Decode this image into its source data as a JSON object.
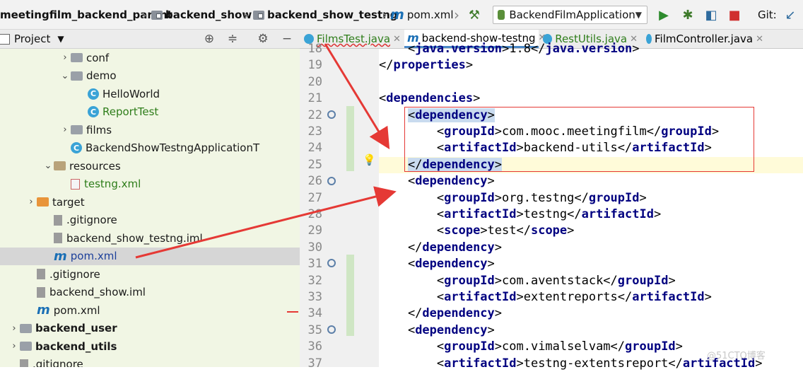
{
  "breadcrumb": {
    "items": [
      "meetingfilm_backend_parent",
      "backend_show",
      "backend_show_testng",
      "pom.xml"
    ]
  },
  "toolbar": {
    "run_config": "BackendFilmApplication",
    "git_label": "Git:"
  },
  "project_panel": {
    "title": "Project",
    "tree": [
      {
        "label": "conf",
        "type": "folder",
        "indent": 2,
        "expanded": false
      },
      {
        "label": "demo",
        "type": "folder",
        "indent": 2,
        "expanded": true
      },
      {
        "label": "HelloWorld",
        "type": "class",
        "indent": 3
      },
      {
        "label": "ReportTest",
        "type": "class",
        "indent": 3,
        "color": "green"
      },
      {
        "label": "films",
        "type": "folder",
        "indent": 2,
        "expanded": false
      },
      {
        "label": "BackendShowTestngApplicationT",
        "type": "class",
        "indent": 2
      },
      {
        "label": "resources",
        "type": "res-folder",
        "indent": 1,
        "expanded": true
      },
      {
        "label": "testng.xml",
        "type": "xml",
        "indent": 2,
        "color": "green"
      },
      {
        "label": "target",
        "type": "folder-orange",
        "indent": 0,
        "expanded": false
      },
      {
        "label": ".gitignore",
        "type": "file",
        "indent": 1
      },
      {
        "label": "backend_show_testng.iml",
        "type": "file",
        "indent": 1
      },
      {
        "label": "pom.xml",
        "type": "maven",
        "indent": 1,
        "selected": true,
        "color": "blue"
      },
      {
        "label": ".gitignore",
        "type": "file",
        "indent": 0
      },
      {
        "label": "backend_show.iml",
        "type": "file",
        "indent": 0
      },
      {
        "label": "pom.xml",
        "type": "maven",
        "indent": 0
      },
      {
        "label": "backend_user",
        "type": "folder",
        "indent": -1,
        "expanded": false,
        "bold": true
      },
      {
        "label": "backend_utils",
        "type": "folder",
        "indent": -1,
        "expanded": false,
        "bold": true
      },
      {
        "label": ".gitignore",
        "type": "file",
        "indent": -1
      }
    ]
  },
  "tabs": [
    {
      "label": "FilmsTest.java",
      "color": "green"
    },
    {
      "label": "backend-show-testng",
      "active": true
    },
    {
      "label": "RestUtils.java",
      "color": "green"
    },
    {
      "label": "FilmController.java"
    }
  ],
  "editor": {
    "lines": [
      {
        "num": "18",
        "text": "    <java.version>1.8</java.version>"
      },
      {
        "num": "19",
        "text": "</properties>"
      },
      {
        "num": "20",
        "text": ""
      },
      {
        "num": "21",
        "text": "<dependencies>"
      },
      {
        "num": "22",
        "text": "    <dependency>"
      },
      {
        "num": "23",
        "text": "        <groupId>com.mooc.meetingfilm</groupId>"
      },
      {
        "num": "24",
        "text": "        <artifactId>backend-utils</artifactId>"
      },
      {
        "num": "25",
        "text": "    </dependency>"
      },
      {
        "num": "26",
        "text": "    <dependency>"
      },
      {
        "num": "27",
        "text": "        <groupId>org.testng</groupId>"
      },
      {
        "num": "28",
        "text": "        <artifactId>testng</artifactId>"
      },
      {
        "num": "29",
        "text": "        <scope>test</scope>"
      },
      {
        "num": "30",
        "text": "    </dependency>"
      },
      {
        "num": "31",
        "text": "    <dependency>"
      },
      {
        "num": "32",
        "text": "        <groupId>com.aventstack</groupId>"
      },
      {
        "num": "33",
        "text": "        <artifactId>extentreports</artifactId>"
      },
      {
        "num": "34",
        "text": "    </dependency>"
      },
      {
        "num": "35",
        "text": "    <dependency>"
      },
      {
        "num": "36",
        "text": "        <groupId>com.vimalselvam</groupId>"
      },
      {
        "num": "37",
        "text": "        <artifactId>testng-extentsreport</artifactId>"
      }
    ]
  },
  "watermark": "@51CTO博客",
  "colors": {
    "annotation": "#e53935",
    "tag": "#000080",
    "selection": "#d6d6d6"
  }
}
